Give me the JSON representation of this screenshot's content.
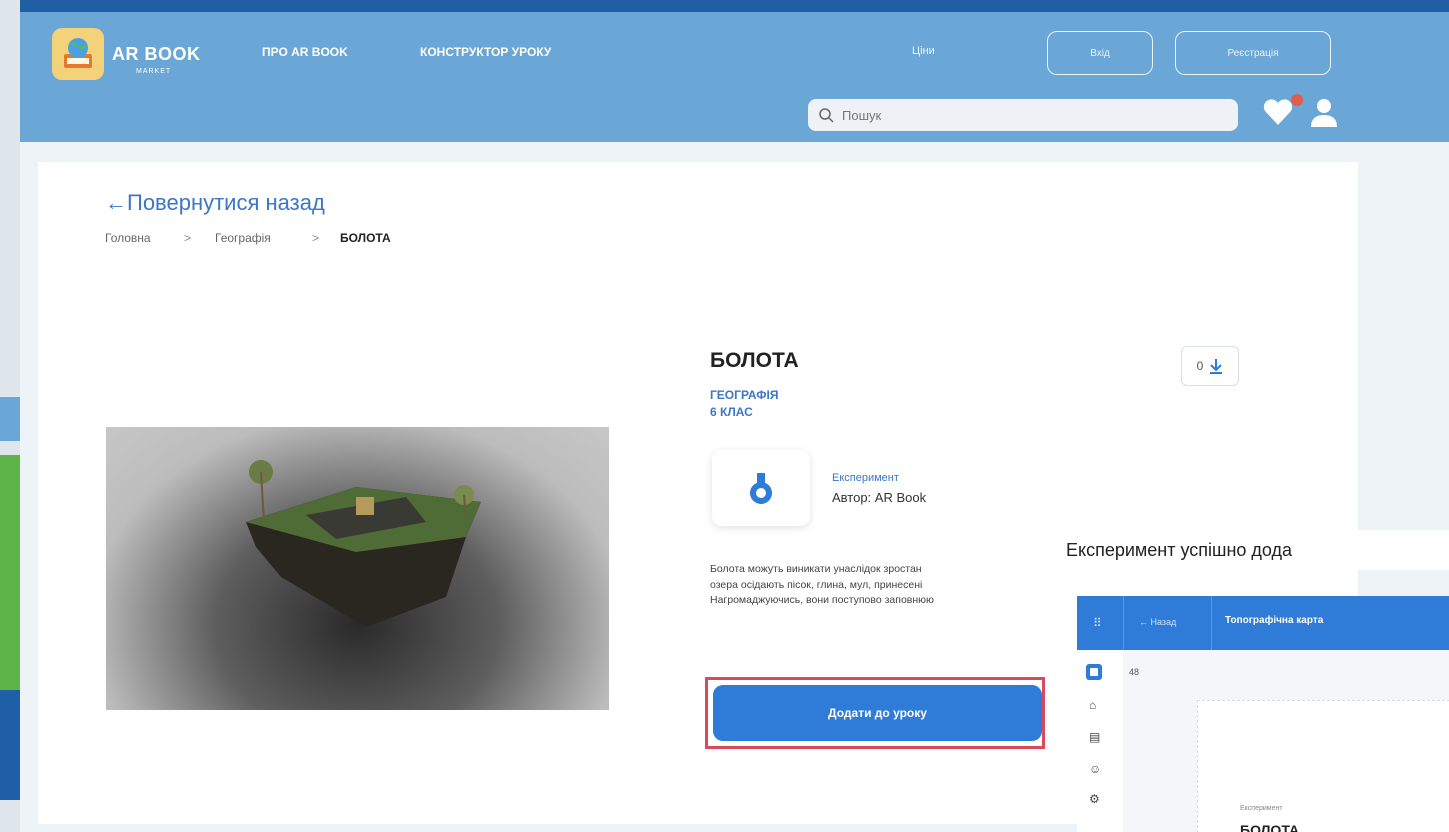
{
  "brand": {
    "name": "AR BOOK",
    "sub": "MARKET"
  },
  "nav": {
    "about": "ПРО AR BOOK",
    "constructor": "КОНСТРУКТОР УРОКУ",
    "prices": "Ціни",
    "login": "Вхід",
    "register": "Реєстрація"
  },
  "search": {
    "placeholder": "Пошук"
  },
  "page": {
    "back": "←Повернутися назад",
    "breadcrumb": [
      "Головна",
      "Географія",
      "БОЛОТА"
    ],
    "breadcrumb_sep": ">",
    "title": "БОЛОТА",
    "subject": "ГЕОГРАФІЯ",
    "grade": "6 КЛАС",
    "downloads": "0",
    "experiment_type": "Експеримент",
    "author": "Автор: AR Book",
    "description_lines": [
      "Болота можуть виникати унаслідок зростан",
      "озера осідають пісок, глина, мул, принесені",
      "Нагромаджуючись, вони поступово заповнюю"
    ],
    "add_button": "Додати до уроку"
  },
  "toast": {
    "message": "Експеримент успішно дода"
  },
  "mini_app": {
    "back": "← Назад",
    "title": "Топографічна карта",
    "zoom": "48",
    "experiment_label": "Експеримент",
    "card_title": "БОЛОТА"
  },
  "colors": {
    "header": "#6aa6d6",
    "top_bar": "#1f5fa6",
    "accent": "#3c76c6",
    "button": "#2e7bd8",
    "highlight_border": "#d94b5a"
  }
}
